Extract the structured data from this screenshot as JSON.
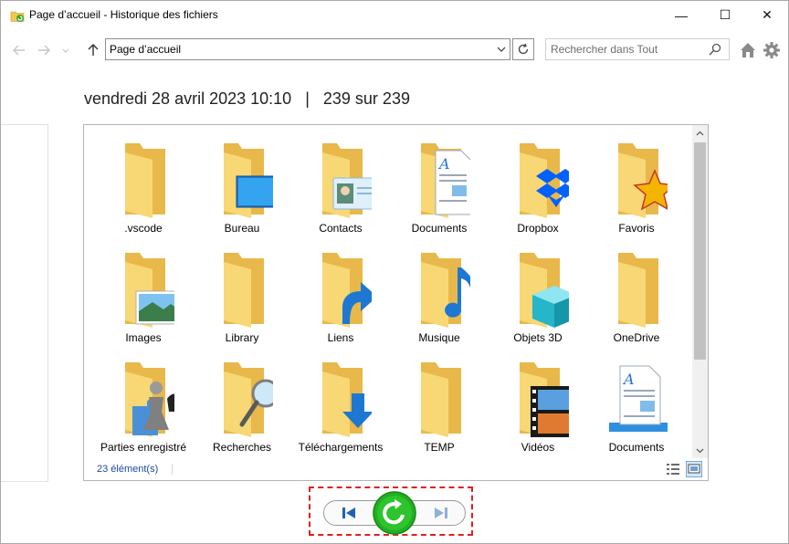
{
  "window": {
    "title": "Page d’accueil - Historique des fichiers",
    "controls": {
      "minimize": "—",
      "maximize": "☐",
      "close": "✕"
    }
  },
  "nav": {
    "back_icon": "arrow-left-icon",
    "forward_icon": "arrow-right-icon",
    "up_icon": "arrow-up-icon",
    "address": "Page d’accueil",
    "search_placeholder": "Rechercher dans Tout"
  },
  "header": {
    "datetime": "vendredi 28 avril 2023 10:10",
    "separator": "|",
    "position": "239 sur 239"
  },
  "items": [
    {
      "label": ".vscode",
      "icon": "folder-icon"
    },
    {
      "label": "Bureau",
      "icon": "desktop-folder-icon"
    },
    {
      "label": "Contacts",
      "icon": "contacts-folder-icon"
    },
    {
      "label": "Documents",
      "icon": "documents-folder-icon"
    },
    {
      "label": "Dropbox",
      "icon": "dropbox-folder-icon"
    },
    {
      "label": "Favoris",
      "icon": "favorites-folder-icon"
    },
    {
      "label": "Images",
      "icon": "pictures-folder-icon"
    },
    {
      "label": "Library",
      "icon": "folder-icon"
    },
    {
      "label": "Liens",
      "icon": "links-folder-icon"
    },
    {
      "label": "Musique",
      "icon": "music-folder-icon"
    },
    {
      "label": "Objets 3D",
      "icon": "3d-objects-folder-icon"
    },
    {
      "label": "OneDrive",
      "icon": "folder-icon"
    },
    {
      "label": "Parties enregistré",
      "icon": "saved-games-folder-icon"
    },
    {
      "label": "Recherches",
      "icon": "searches-folder-icon"
    },
    {
      "label": "Téléchargements",
      "icon": "downloads-folder-icon"
    },
    {
      "label": "TEMP",
      "icon": "folder-icon"
    },
    {
      "label": "Vidéos",
      "icon": "videos-folder-icon"
    },
    {
      "label": "Documents",
      "icon": "document-library-icon"
    }
  ],
  "status": {
    "count": "23 élément(s)"
  },
  "colors": {
    "folder": "#f8d775",
    "folder_dark": "#e8b84a",
    "accent_blue": "#1e78d2",
    "restore_green": "#22b022",
    "highlight_red": "#e02020"
  }
}
